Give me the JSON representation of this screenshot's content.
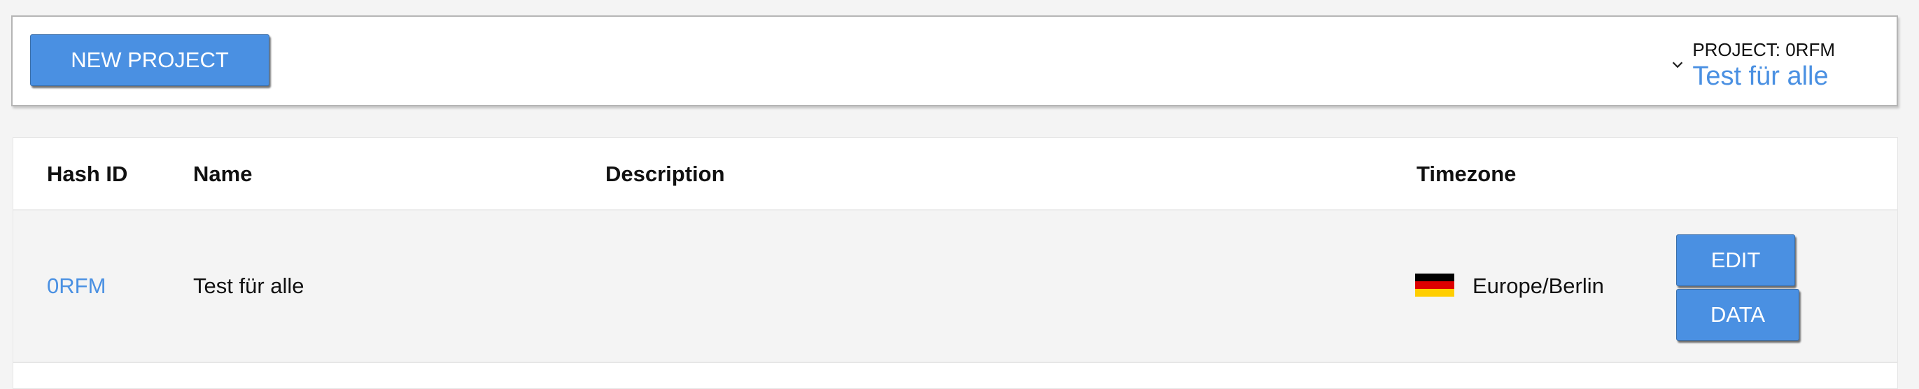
{
  "topbar": {
    "new_project_label": "NEW PROJECT",
    "project_caption": "PROJECT: 0RFM",
    "project_name": "Test für alle"
  },
  "table": {
    "columns": [
      "Hash ID",
      "Name",
      "Description",
      "Timezone"
    ],
    "rows": [
      {
        "hash_id": "0RFM",
        "name": "Test für alle",
        "description": "",
        "timezone": "Europe/Berlin",
        "flag": "germany-flag",
        "edit_label": "EDIT",
        "data_label": "DATA"
      }
    ]
  },
  "colors": {
    "accent": "#4a90e2",
    "background": "#f4f4f4",
    "flag_black": "#000000",
    "flag_red": "#dd0000",
    "flag_gold": "#ffce00"
  },
  "icons": {
    "project_dropdown": "chevron-down-icon"
  }
}
